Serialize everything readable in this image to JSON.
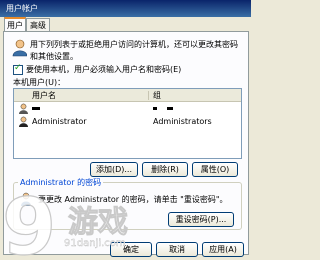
{
  "window": {
    "title": "用户帐户"
  },
  "tabs": [
    {
      "label": "用户"
    },
    {
      "label": "高级"
    }
  ],
  "intro_text": "用下列列表于或拒绝用户访问的计算机，还可以更改其密码和其他设置。",
  "must_login_checkbox": {
    "label": "要使用本机，用户必须输入用户名和密码(E)",
    "checked": true
  },
  "list_label": "本机用户(U)：",
  "table": {
    "columns": [
      "用户名",
      "组"
    ],
    "rows": [
      {
        "username": "",
        "group": ""
      },
      {
        "username": "Administrator",
        "group": "Administrators"
      }
    ]
  },
  "buttons": {
    "add": "添加(D)...",
    "remove": "删除(R)",
    "properties": "属性(O)"
  },
  "password_group": {
    "label": "Administrator 的密码",
    "text": "要更改 Administrator 的密码，请单击 \"重设密码\"。",
    "reset_button": "重设密码(P)..."
  },
  "dialog_buttons": {
    "ok": "确定",
    "cancel": "取消",
    "apply": "应用(A)"
  },
  "watermark": {
    "logo": "9",
    "text": "游戏",
    "site": "91danji.com"
  }
}
